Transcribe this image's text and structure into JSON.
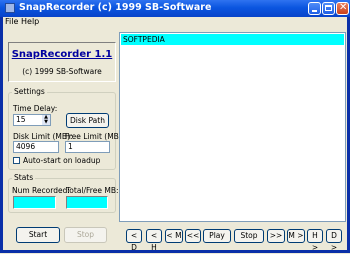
{
  "window": {
    "title": "SnapRecorder  (c) 1999 SB-Software"
  },
  "menu": {
    "file": "File",
    "help": "Help"
  },
  "header": {
    "app_name": "SnapRecorder 1.1",
    "copyright": "(c) 1999 SB-Software"
  },
  "settings": {
    "group_label": "Settings",
    "time_delay_label": "Time Delay:",
    "time_delay_value": "15",
    "disk_path_button": "Disk Path",
    "disk_limit_label": "Disk Limit (MB):",
    "disk_limit_value": "4096",
    "free_limit_label": "Free Limit (MB):",
    "free_limit_value": "1",
    "autostart_label": "Auto-start on loadup"
  },
  "stats": {
    "group_label": "Stats",
    "num_recorded_label": "Num Recorded:",
    "total_free_label": "Total/Free MB:"
  },
  "controls": {
    "start": "Start",
    "stop": "Stop"
  },
  "list": {
    "items": [
      "SOFTPEDIA"
    ],
    "selection_color": "#00FFFF"
  },
  "playback": {
    "first": "< D",
    "prev_h": "< H",
    "prev_m": "< M",
    "back": "<<",
    "play": "Play",
    "stop": "Stop",
    "forward": ">>",
    "next_m": "M >",
    "next_h": "H >",
    "last": "D >"
  },
  "colors": {
    "cyan": "#00FFFF",
    "title_blue": "#0B55E0",
    "face": "#ECE9D8"
  }
}
